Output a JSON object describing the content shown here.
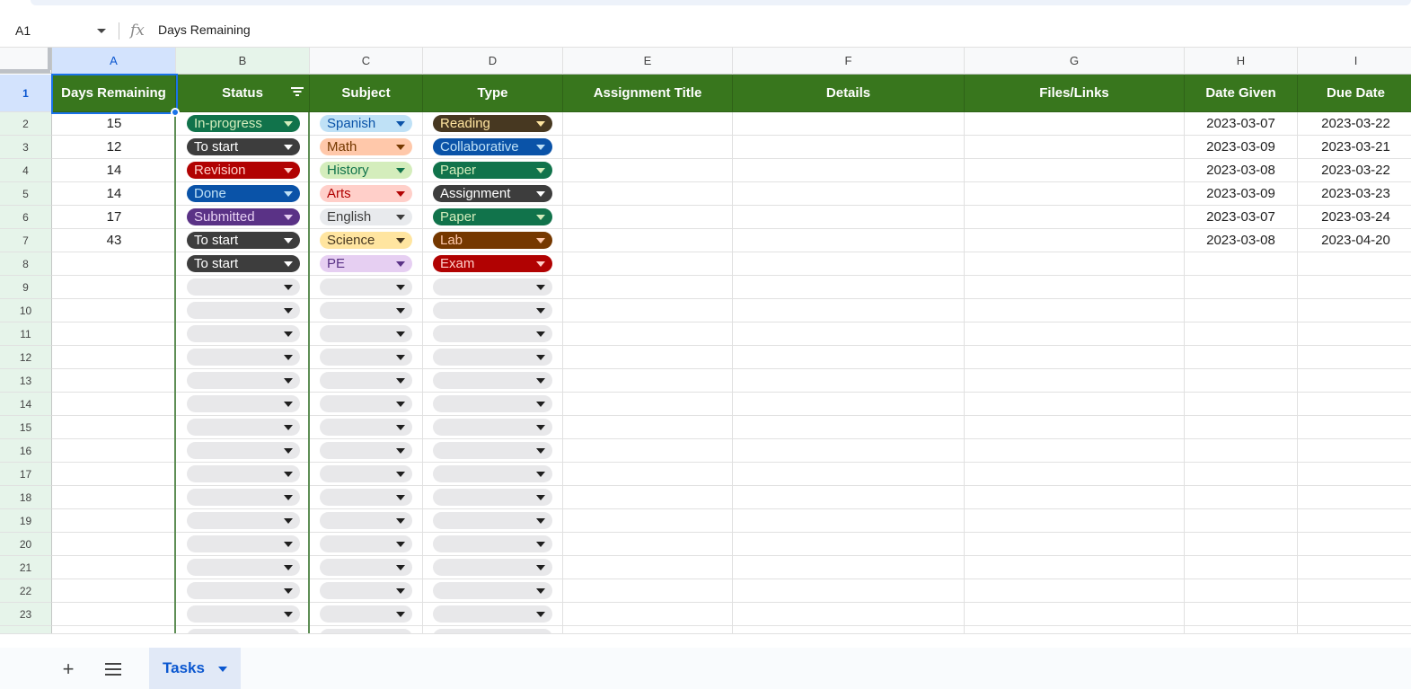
{
  "formula_bar": {
    "cell_ref": "A1",
    "fx_label": "fx",
    "value": "Days Remaining"
  },
  "columns": [
    {
      "letter": "A",
      "header": "Days Remaining"
    },
    {
      "letter": "B",
      "header": "Status"
    },
    {
      "letter": "C",
      "header": "Subject"
    },
    {
      "letter": "D",
      "header": "Type"
    },
    {
      "letter": "E",
      "header": "Assignment Title"
    },
    {
      "letter": "F",
      "header": "Details"
    },
    {
      "letter": "G",
      "header": "Files/Links"
    },
    {
      "letter": "H",
      "header": "Date Given"
    },
    {
      "letter": "I",
      "header": "Due Date"
    }
  ],
  "row_numbers": [
    "1",
    "2",
    "3",
    "4",
    "5",
    "6",
    "7",
    "8",
    "9",
    "10",
    "11",
    "12",
    "13",
    "14",
    "15",
    "16",
    "17",
    "18",
    "19",
    "20",
    "21",
    "22",
    "23"
  ],
  "rows": [
    {
      "days": "15",
      "status": "In-progress",
      "subject": "Spanish",
      "type": "Reading",
      "given": "2023-03-07",
      "due": "2023-03-22"
    },
    {
      "days": "12",
      "status": "To start",
      "subject": "Math",
      "type": "Collaborative",
      "given": "2023-03-09",
      "due": "2023-03-21"
    },
    {
      "days": "14",
      "status": "Revision",
      "subject": "History",
      "type": "Paper",
      "given": "2023-03-08",
      "due": "2023-03-22"
    },
    {
      "days": "14",
      "status": "Done",
      "subject": "Arts",
      "type": "Assignment",
      "given": "2023-03-09",
      "due": "2023-03-23"
    },
    {
      "days": "17",
      "status": "Submitted",
      "subject": "English",
      "type": "Paper",
      "given": "2023-03-07",
      "due": "2023-03-24"
    },
    {
      "days": "43",
      "status": "To start",
      "subject": "Science",
      "type": "Lab",
      "given": "2023-03-08",
      "due": "2023-04-20"
    },
    {
      "days": "",
      "status": "To start",
      "subject": "PE",
      "type": "Exam",
      "given": "",
      "due": ""
    }
  ],
  "chip_colors": {
    "status": {
      "In-progress": {
        "bg": "#11734b",
        "fg": "#d4edbc"
      },
      "To start": {
        "bg": "#3d3d3d",
        "fg": "#ffffff"
      },
      "Revision": {
        "bg": "#b10202",
        "fg": "#ffcfc9"
      },
      "Done": {
        "bg": "#0a53a8",
        "fg": "#bfe1f6"
      },
      "Submitted": {
        "bg": "#5a3286",
        "fg": "#e6cff2"
      }
    },
    "subject": {
      "Spanish": {
        "bg": "#bfe1f6",
        "fg": "#0a53a8"
      },
      "Math": {
        "bg": "#ffc8aa",
        "fg": "#753800"
      },
      "History": {
        "bg": "#d4edbc",
        "fg": "#11734b"
      },
      "Arts": {
        "bg": "#ffcfc9",
        "fg": "#b10202"
      },
      "English": {
        "bg": "#e8eaed",
        "fg": "#3d3d3d"
      },
      "Science": {
        "bg": "#ffe5a0",
        "fg": "#473821"
      },
      "PE": {
        "bg": "#e6cff2",
        "fg": "#5a3286"
      }
    },
    "type": {
      "Reading": {
        "bg": "#473821",
        "fg": "#ffe5a0"
      },
      "Collaborative": {
        "bg": "#0a53a8",
        "fg": "#bfe1f6"
      },
      "Paper": {
        "bg": "#11734b",
        "fg": "#d4edbc"
      },
      "Assignment": {
        "bg": "#3d3d3d",
        "fg": "#ffffff"
      },
      "Lab": {
        "bg": "#753800",
        "fg": "#ffc8aa"
      },
      "Exam": {
        "bg": "#b10202",
        "fg": "#ffcfc9"
      }
    }
  },
  "header_color": "#38761d",
  "sheet_tabs": [
    {
      "label": "Tasks",
      "active": true
    }
  ],
  "icons": {
    "add_sheet": "plus-icon",
    "all_sheets": "hamburger-icon",
    "filter": "filter-icon"
  }
}
